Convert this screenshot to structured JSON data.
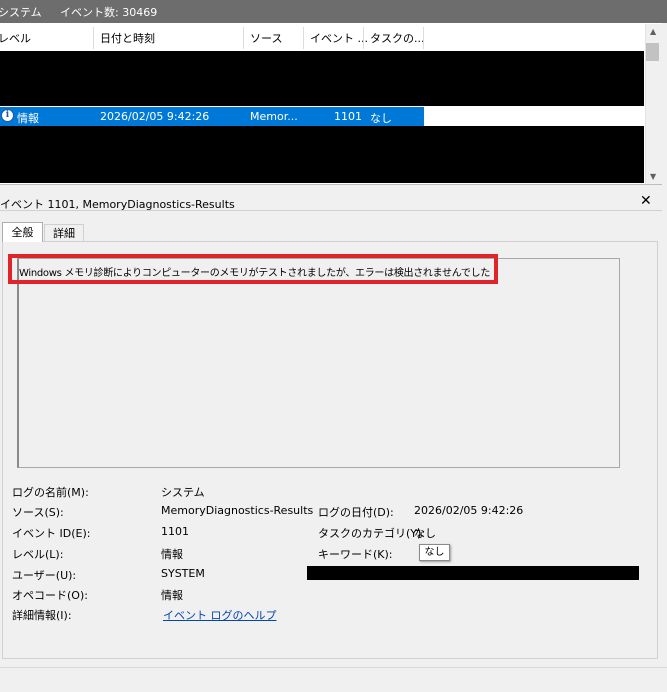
{
  "titlebar": {
    "log_name": "システム",
    "event_count": "イベント数: 30469"
  },
  "list": {
    "columns": [
      "レベル",
      "日付と時刻",
      "ソース",
      "イベント ...",
      "タスクの..."
    ],
    "selected_row": {
      "level": "情報",
      "datetime": "2026/02/05 9:42:26",
      "source": "Memor...",
      "event_id": "1101",
      "task": "なし"
    }
  },
  "detail": {
    "title": "イベント 1101, MemoryDiagnostics-Results",
    "tabs": [
      "全般",
      "詳細"
    ],
    "message": "Windows メモリ診断によりコンピューターのメモリがテストされましたが、エラーは検出されませんでした",
    "props": {
      "log_name_label": "ログの名前(M):",
      "log_name_value": "システム",
      "source_label": "ソース(S):",
      "source_value": "MemoryDiagnostics-Results",
      "logged_label": "ログの日付(D):",
      "logged_value": "2026/02/05 9:42:26",
      "event_id_label": "イベント ID(E):",
      "event_id_value": "1101",
      "task_label": "タスクのカテゴリ(Y):",
      "task_value": "なし",
      "level_label": "レベル(L):",
      "level_value": "情報",
      "keywords_label": "キーワード(K):",
      "keywords_tooltip": "なし",
      "user_label": "ユーザー(U):",
      "user_value": "SYSTEM",
      "opcode_label": "オペコード(O):",
      "opcode_value": "情報",
      "more_label": "詳細情報(I):",
      "more_link": "イベント ログのヘルプ"
    }
  },
  "colors": {
    "selection": "#0078d7",
    "highlight_box": "#e0242c",
    "titlebar": "#6d6d6d"
  }
}
